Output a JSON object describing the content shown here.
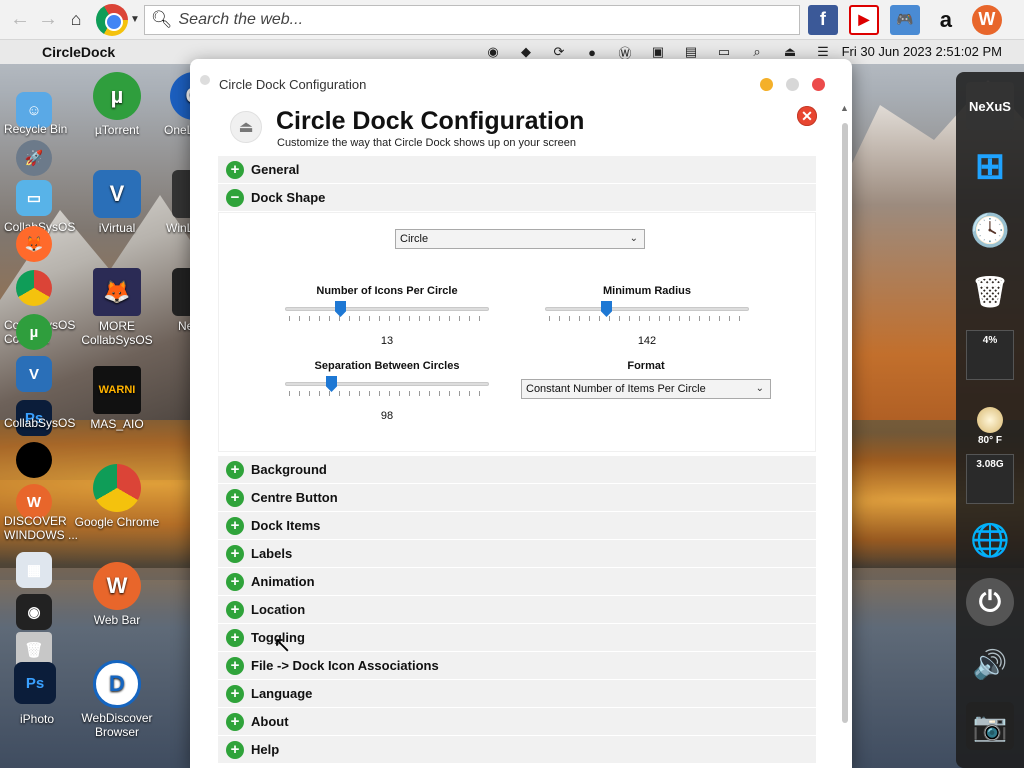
{
  "browser": {
    "search_placeholder": "Search the web...",
    "bookmarks": [
      {
        "name": "facebook",
        "glyph": "f"
      },
      {
        "name": "youtube",
        "glyph": "▶"
      },
      {
        "name": "games",
        "glyph": "🎮"
      },
      {
        "name": "amazon",
        "glyph": "a"
      },
      {
        "name": "webbar",
        "glyph": "W"
      }
    ]
  },
  "menubar": {
    "app_name": "CircleDock",
    "clock": "Fri 30 Jun 2023  2:51:02 PM"
  },
  "desktop": {
    "icons": [
      {
        "label": "Recycle Bin",
        "glyph": "🗑"
      },
      {
        "label": "µTorrent",
        "glyph": "µ"
      },
      {
        "label": "OneL",
        "glyph": "O"
      },
      {
        "label": "CollabSysOS",
        "glyph": ""
      },
      {
        "label": "iVirtual",
        "glyph": "V"
      },
      {
        "label": "WinL",
        "glyph": ""
      },
      {
        "label": "CollabSysOS",
        "glyph": ""
      },
      {
        "label": "MORE CollabSysOS",
        "glyph": "🦊"
      },
      {
        "label": "Ne",
        "glyph": ""
      },
      {
        "label": "MAS_AIO",
        "glyph": "W"
      },
      {
        "label": "DISCOVER WINDOWS ...",
        "glyph": "W"
      },
      {
        "label": "Google Chrome",
        "glyph": ""
      },
      {
        "label": "Web Bar",
        "glyph": "W"
      },
      {
        "label": "iPhoto",
        "glyph": "Ps"
      },
      {
        "label": "WebDiscover Browser",
        "glyph": "D"
      }
    ],
    "left_dock_labels": [
      "Recycle Bin",
      "CollabSysOS",
      "CollabSysOS Connect",
      "CollabSysOS",
      "DISCOVER WINDOWS ...",
      "iPhoto"
    ]
  },
  "right_dock": {
    "items": [
      {
        "name": "nexus",
        "text": "NeXuS"
      },
      {
        "name": "windows",
        "text": "⊞"
      },
      {
        "name": "clock",
        "text": "🕓"
      },
      {
        "name": "trash",
        "text": "🗑"
      },
      {
        "name": "cpu-meter",
        "text": "4%"
      },
      {
        "name": "weather",
        "text": "80° F"
      },
      {
        "name": "memory",
        "text": "3.08G"
      },
      {
        "name": "network-globe",
        "text": "🌐"
      },
      {
        "name": "power",
        "text": "⏻"
      },
      {
        "name": "speaker",
        "text": "🔊"
      },
      {
        "name": "camera",
        "text": "📷"
      }
    ]
  },
  "window": {
    "title": "Circle Dock Configuration",
    "heading": "Circle Dock Configuration",
    "subheading": "Customize the way that Circle Dock shows up on your screen",
    "sections_before": [
      {
        "label": "General",
        "expanded": false
      },
      {
        "label": "Dock Shape",
        "expanded": true
      }
    ],
    "dock_shape": {
      "shape_select": "Circle",
      "icons_per_circle_label": "Number of Icons Per Circle",
      "icons_per_circle_value": "13",
      "icons_per_circle_fraction": 0.26,
      "min_radius_label": "Minimum Radius",
      "min_radius_value": "142",
      "min_radius_fraction": 0.29,
      "separation_label": "Separation Between Circles",
      "separation_value": "98",
      "separation_fraction": 0.21,
      "format_label": "Format",
      "format_select": "Constant Number of Items Per Circle"
    },
    "sections_after": [
      {
        "label": "Background"
      },
      {
        "label": "Centre Button"
      },
      {
        "label": "Dock Items"
      },
      {
        "label": "Labels"
      },
      {
        "label": "Animation"
      },
      {
        "label": "Location"
      },
      {
        "label": "Toggling"
      },
      {
        "label": "File -> Dock Icon Associations"
      },
      {
        "label": "Language"
      },
      {
        "label": "About"
      },
      {
        "label": "Help"
      }
    ]
  },
  "colors": {
    "accent": "#1e78d4",
    "expand_green": "#2fa33a",
    "close_red": "#e84530"
  }
}
